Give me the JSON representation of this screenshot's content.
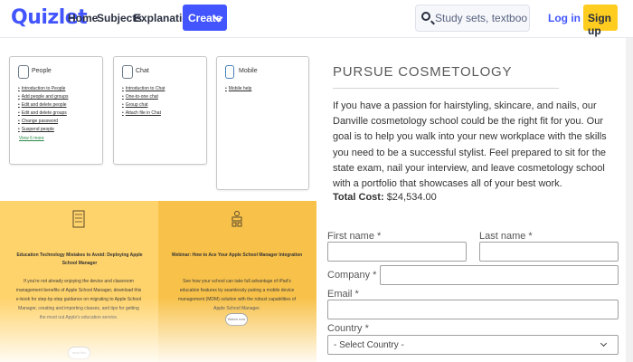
{
  "nav": {
    "logo": "Quizlet",
    "links": [
      "Home",
      "Subjects",
      "Explanations"
    ],
    "create_label": "Create",
    "search_placeholder": "Study sets, textbooks, ...",
    "login_label": "Log in",
    "signup_label": "Sign up",
    "accent_color": "#4255ff",
    "signup_color": "#ffcd1f"
  },
  "help_cards": [
    {
      "title": "People",
      "icon": "person-icon",
      "links": [
        "Introduction to People",
        "Add people and groups",
        "Edit and delete people",
        "Edit and delete groups",
        "Change password",
        "Suspend people"
      ],
      "view_more": "View 6 more"
    },
    {
      "title": "Chat",
      "icon": "chat-icon",
      "links": [
        "Introduction to Chat",
        "One-to-one chat",
        "Group chat",
        "Attach file in Chat"
      ]
    },
    {
      "title": "Mobile",
      "icon": "mobile-icon",
      "links": [
        "Mobile help"
      ]
    }
  ],
  "promos": [
    {
      "icon": "document-list-icon",
      "title": "Education Technology Mistakes to Avoid: Deploying Apple School Manager",
      "body": "If you're not already enjoying the device and classroom management benefits of Apple School Manager, download this e-book for step-by-step guidance on migrating to Apple School Manager, creating and importing classes, and tips for getting the most out Apple's education service.",
      "button": "read this",
      "background": "#ffd36b"
    },
    {
      "icon": "classroom-icon",
      "title": "Webinar: How to Ace Your Apple School Manager Integration",
      "body": "See how your school can take full advantage of iPad's education features by seamlessly pairing a mobile device management (MDM) solution with the robust capabilities of Apple School Manager.",
      "button": "Watch now",
      "background": "#f8c24a"
    }
  ],
  "program": {
    "heading": "PURSUE COSMETOLOGY",
    "description": "If you have a passion for hairstyling, skincare, and nails, our Danville cosmetology school could be the right fit for you. Our goal is to help you walk into your new workplace with the skills you need to be a successful stylist. Feel prepared to sit for the state exam, nail your interview, and leave cosmetology school with a portfolio that showcases all of your best work.",
    "cost_label": "Total Cost:",
    "cost_value": "$24,534.00"
  },
  "form": {
    "first_name_label": "First name *",
    "last_name_label": "Last name *",
    "company_label": "Company *",
    "email_label": "Email *",
    "country_label": "Country *",
    "country_selected": "- Select Country -"
  }
}
